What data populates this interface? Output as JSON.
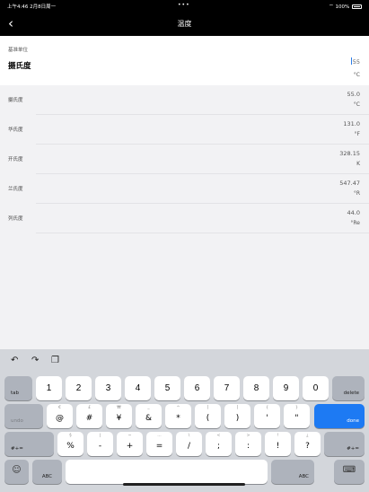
{
  "status_bar": {
    "time_date": "上午4:46  2月8日周一",
    "dots": "•••",
    "battery": "100%"
  },
  "nav": {
    "title": "温度"
  },
  "base": {
    "label": "基准单位",
    "unit": "摄氏度",
    "value": "55",
    "symbol": "°C"
  },
  "rows": [
    {
      "name": "摄氏度",
      "value": "55.0",
      "symbol": "°C"
    },
    {
      "name": "华氏度",
      "value": "131.0",
      "symbol": "°F"
    },
    {
      "name": "开氏度",
      "value": "328.15",
      "symbol": "K"
    },
    {
      "name": "兰氏度",
      "value": "547.47",
      "symbol": "°R"
    },
    {
      "name": "列氏度",
      "value": "44.0",
      "symbol": "°Re"
    }
  ],
  "keyboard": {
    "tab": "tab",
    "delete": "delete",
    "undo": "undo",
    "done": "done",
    "shift_left": "#+=",
    "shift_right": "#+=",
    "abc_left": "ABC",
    "abc_right": "ABC",
    "row1": [
      {
        "main": "1"
      },
      {
        "main": "2"
      },
      {
        "main": "3"
      },
      {
        "main": "4"
      },
      {
        "main": "5"
      },
      {
        "main": "6"
      },
      {
        "main": "7"
      },
      {
        "main": "8"
      },
      {
        "main": "9"
      },
      {
        "main": "0"
      }
    ],
    "row2": [
      {
        "top": "€",
        "bot": "@"
      },
      {
        "top": "£",
        "bot": "#"
      },
      {
        "top": "₩",
        "bot": "¥"
      },
      {
        "top": "_",
        "bot": "&"
      },
      {
        "top": "^",
        "bot": "*"
      },
      {
        "top": "[",
        "bot": "("
      },
      {
        "top": "]",
        "bot": ")"
      },
      {
        "top": "{",
        "bot": "'"
      },
      {
        "top": "}",
        "bot": "\""
      }
    ],
    "row3": [
      {
        "top": "§",
        "bot": "%"
      },
      {
        "top": "|",
        "bot": "-"
      },
      {
        "top": "~",
        "bot": "+"
      },
      {
        "top": "…",
        "bot": "="
      },
      {
        "top": "\\",
        "bot": "/"
      },
      {
        "top": "<",
        "bot": ";"
      },
      {
        "top": ">",
        "bot": ":"
      },
      {
        "top": "!",
        "bot": "!"
      },
      {
        "top": "¿",
        "bot": "?"
      }
    ]
  }
}
